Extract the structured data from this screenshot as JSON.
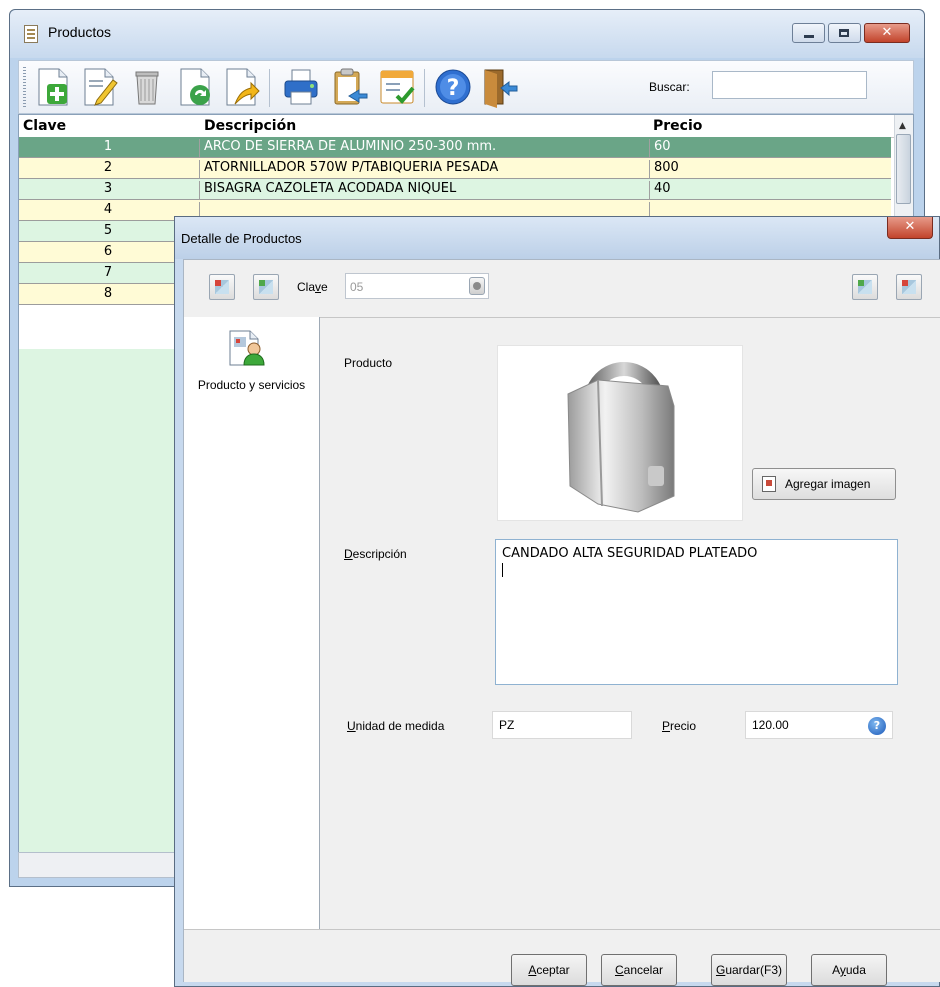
{
  "main_window": {
    "title": "Productos",
    "search_label": "Buscar:",
    "search_value": "",
    "toolbar_icons": [
      "add-document-icon",
      "edit-document-icon",
      "trash-icon",
      "refresh-document-icon",
      "export-document-icon",
      "print-icon",
      "clipboard-icon",
      "checklist-icon",
      "help-icon",
      "exit-door-icon"
    ],
    "grid": {
      "headers": [
        "Clave",
        "Descripción",
        "Precio"
      ],
      "rows": [
        {
          "clave": "1",
          "descripcion": "ARCO DE SIERRA DE ALUMINIO 250-300 mm.",
          "precio": "60"
        },
        {
          "clave": "2",
          "descripcion": "ATORNILLADOR 570W P/TABIQUERIA PESADA",
          "precio": "800"
        },
        {
          "clave": "3",
          "descripcion": "BISAGRA CAZOLETA ACODADA NIQUEL",
          "precio": "40"
        },
        {
          "clave": "4",
          "descripcion": "",
          "precio": ""
        },
        {
          "clave": "5",
          "descripcion": "",
          "precio": ""
        },
        {
          "clave": "6",
          "descripcion": "",
          "precio": ""
        },
        {
          "clave": "7",
          "descripcion": "",
          "precio": ""
        },
        {
          "clave": "8",
          "descripcion": "",
          "precio": ""
        }
      ]
    }
  },
  "dialog": {
    "title": "Detalle de Productos",
    "clave_label": "Clave",
    "clave_value": "05",
    "sidebar_item_label": "Producto y servicios",
    "producto_label": "Producto",
    "add_image_button": "Agregar imagen",
    "descripcion_label": "Descripción",
    "descripcion_value": "CANDADO ALTA SEGURIDAD PLATEADO",
    "unidad_label": "Unidad de medida",
    "unidad_value": "PZ",
    "precio_label": "Precio",
    "precio_value": "120.00",
    "buttons": {
      "aceptar": "Aceptar",
      "cancelar": "Cancelar",
      "guardar": "Guardar(F3)",
      "ayuda": "Ayuda"
    }
  },
  "colors": {
    "selected_row": "#6aa587",
    "row_alt_yellow": "#fffbd6",
    "row_alt_green": "#ddf5e2",
    "close_button": "#c2442c"
  }
}
